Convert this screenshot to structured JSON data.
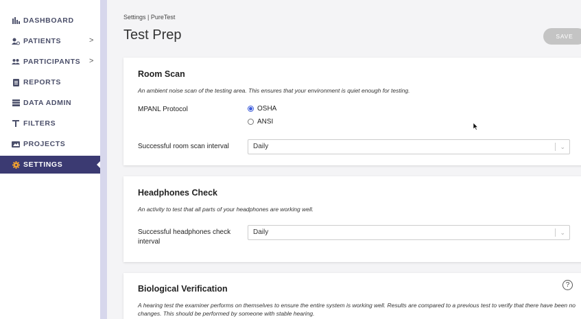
{
  "sidebar": {
    "items": [
      {
        "label": "DASHBOARD",
        "icon": "bar-chart-icon"
      },
      {
        "label": "PATIENTS",
        "icon": "patients-icon",
        "chevron": ">"
      },
      {
        "label": "PARTICIPANTS",
        "icon": "participants-icon",
        "chevron": ">"
      },
      {
        "label": "REPORTS",
        "icon": "report-icon"
      },
      {
        "label": "DATA ADMIN",
        "icon": "database-icon"
      },
      {
        "label": "FILTERS",
        "icon": "filter-icon"
      },
      {
        "label": "PROJECTS",
        "icon": "projects-icon"
      },
      {
        "label": "SETTINGS",
        "icon": "gear-icon",
        "active": true
      }
    ]
  },
  "header": {
    "breadcrumb": "Settings | PureTest",
    "title": "Test Prep",
    "save_label": "SAVE"
  },
  "room_scan": {
    "title": "Room Scan",
    "description": "An ambient noise scan of the testing area. This ensures that your environment is quiet enough for testing.",
    "protocol_label": "MPANL Protocol",
    "options": [
      "OSHA",
      "ANSI"
    ],
    "selected": "OSHA",
    "interval_label": "Successful room scan interval",
    "interval_value": "Daily"
  },
  "headphones": {
    "title": "Headphones Check",
    "description": "An activity to test that all parts of your headphones are working well.",
    "interval_label_line1": "Successful headphones check",
    "interval_label_line2": "interval",
    "interval_value": "Daily"
  },
  "bio": {
    "title": "Biological Verification",
    "description": "A hearing test the examiner performs on themselves to ensure the entire system is working well. Results are compared to a previous test to verify that there have been no changes. This should be performed by someone with stable hearing.",
    "help": "?"
  },
  "colors": {
    "accent": "#3b3a72",
    "radio": "#3b5bdb",
    "strip": "#d7d7ec"
  }
}
